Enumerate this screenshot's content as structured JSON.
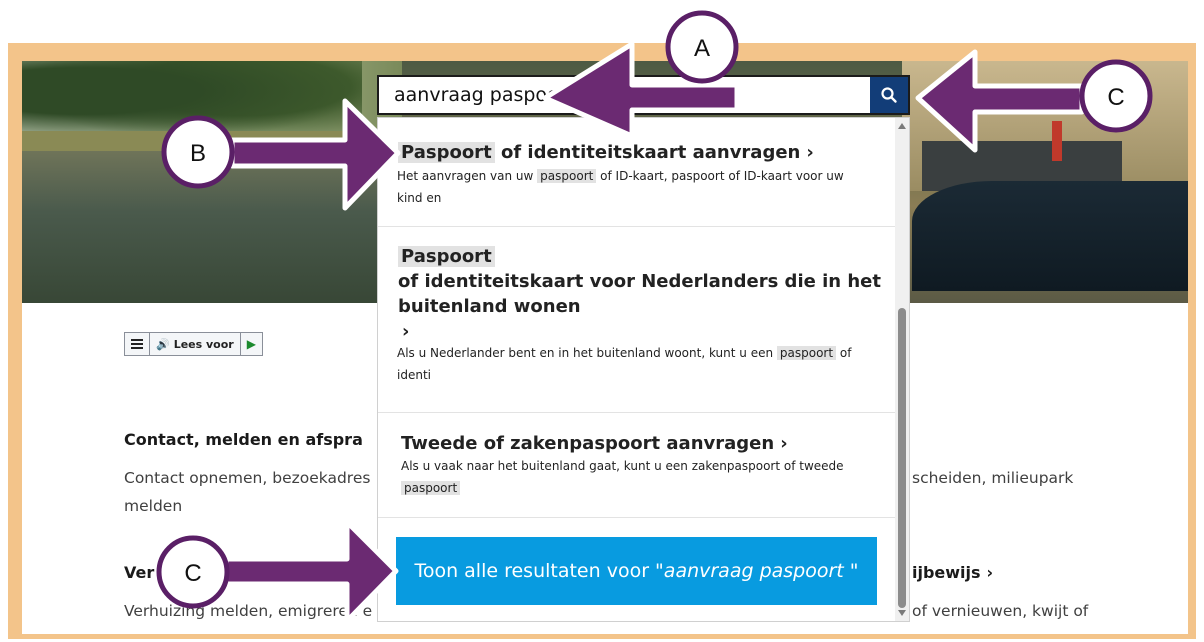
{
  "search": {
    "value": "aanvraag paspoort",
    "button_icon": "search-icon"
  },
  "read_aloud": {
    "menu_icon": "menu-icon",
    "speaker_icon": "speaker-icon",
    "label": "Lees voor",
    "play_icon": "play-icon"
  },
  "sections": [
    {
      "heading": "Contact, melden en afspra",
      "text_left_1": "Contact opnemen, bezoekadres",
      "text_right_1": "scheiden, milieupark",
      "text_left_2": "melden"
    },
    {
      "heading_left": "Ver",
      "heading_right": "ijbewijs",
      "text_left": "Verhuizing melden, emigreren e",
      "text_right": "of vernieuwen, kwijt of"
    }
  ],
  "results": [
    {
      "title_hl": "Paspoort",
      "title_rest": "of identiteitskaart aanvragen",
      "desc_before": "Het aanvragen van uw",
      "desc_hl": "paspoort",
      "desc_after": "of ID-kaart, paspoort of ID-kaart voor uw",
      "desc_line2": "kind en"
    },
    {
      "title_hl": "Paspoort",
      "title_line2": "of identiteitskaart voor Nederlanders die in het",
      "title_line3": "buitenland wonen",
      "desc_before": "Als u Nederlander bent en in het buitenland woont, kunt u een",
      "desc_hl": "paspoort",
      "desc_after": "of",
      "desc_line2": "identi"
    },
    {
      "title": "Tweede of zakenpaspoort aanvragen",
      "desc_line1": "Als u vaak naar het buitenland gaat, kunt u een zakenpaspoort of tweede",
      "desc_hl": "paspoort"
    }
  ],
  "show_all": {
    "prefix": "Toon alle resultaten voor \"",
    "query": "aanvraag paspoort",
    "suffix": " \""
  },
  "callouts": {
    "a": "A",
    "b": "B",
    "c_top": "C",
    "c_bottom": "C"
  },
  "colors": {
    "frame": "#f3c48a",
    "arrow": "#6b2a72",
    "search_button": "#123d78",
    "show_all_button": "#089be0"
  }
}
